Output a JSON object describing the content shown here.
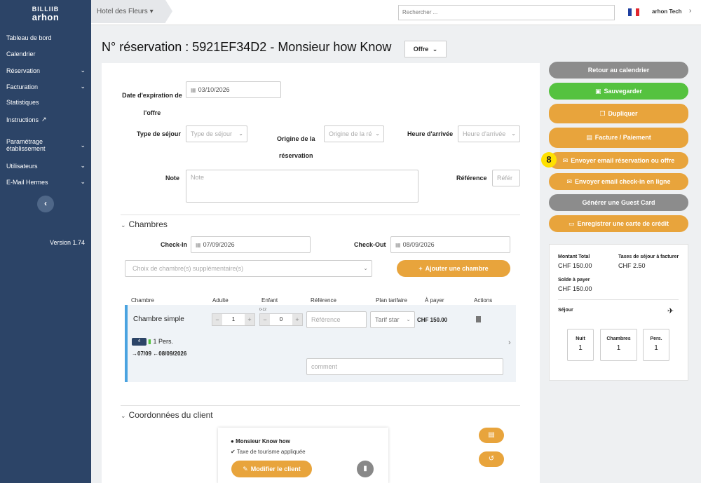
{
  "sidebar": {
    "logo_top": "BILLIIB",
    "logo_bottom": "arhon",
    "items": [
      {
        "label": "Tableau de bord"
      },
      {
        "label": "Calendrier"
      },
      {
        "label": "Réservation"
      },
      {
        "label": "Facturation"
      },
      {
        "label": "Statistiques"
      },
      {
        "label": "Instructions"
      },
      {
        "label": "Paramétrage établissement"
      },
      {
        "label": "Utilisateurs"
      },
      {
        "label": "E-Mail Hermes"
      }
    ],
    "version": "Version 1.74"
  },
  "topbar": {
    "hotel": "Hotel des Fleurs",
    "search_placeholder": "Rechercher ...",
    "user": "arhon Tech"
  },
  "page": {
    "title": "N° réservation : 5921EF34D2 - Monsieur how Know",
    "type_button": "Offre"
  },
  "form": {
    "expiration_label": "Date d'expiration de l'offre",
    "expiration_line1": "Date d'expiration de",
    "expiration_line2": "l'offre",
    "expiration_value": "03/10/2026",
    "sejour_label": "Type de séjour",
    "sejour_placeholder": "Type de séjour",
    "origine_line1": "Origine de la",
    "origine_line2": "réservation",
    "origine_placeholder": "Origine de la ré",
    "arrivee_label": "Heure d'arrivée",
    "arrivee_placeholder": "Heure d'arrivée",
    "note_label": "Note",
    "note_placeholder": "Note",
    "reference_label": "Référence",
    "reference_placeholder": "Référ"
  },
  "chambres": {
    "title": "Chambres",
    "checkin_label": "Check-In",
    "checkin_value": "07/09/2026",
    "checkout_label": "Check-Out",
    "checkout_value": "08/09/2026",
    "extra_placeholder": "Choix de chambre(s) supplémentaire(s)",
    "add_button": "Ajouter une chambre",
    "columns": [
      "Chambre",
      "Adulte",
      "Enfant",
      "Référence",
      "Plan tarifaire",
      "À payer",
      "Actions"
    ],
    "child_range": "0-12",
    "rows": [
      {
        "name": "Chambre simple",
        "adults": "1",
        "children": "0",
        "reference_placeholder": "Référence",
        "plan": "Tarif star",
        "amount": "CHF 150.00",
        "bed_badge": "4",
        "persons": "1 Pers.",
        "dates": "07/09",
        "dates_end": "08/09/2026",
        "comment_placeholder": "comment"
      }
    ]
  },
  "client": {
    "title": "Coordonnées du client",
    "name": "Monsieur  Know how",
    "tax": "Taxe de tourisme appliquée",
    "edit_button": "Modifier le client"
  },
  "actions": {
    "retour": "Retour au calendrier",
    "save": "Sauvegarder",
    "duplicate": "Dupliquer",
    "invoice": "Facture / Paiement",
    "email_offer": "Envoyer email réservation ou offre",
    "email_checkin": "Envoyer email check-in en ligne",
    "guest_card": "Générer une Guest Card",
    "credit_card": "Enregistrer une carte de crédit",
    "step_badge": "8"
  },
  "summary": {
    "montant_label": "Montant Total",
    "montant_value": "CHF 150.00",
    "taxes_label": "Taxes de séjour à facturer",
    "taxes_value": "CHF 2.50",
    "solde_label": "Solde à payer",
    "solde_value": "CHF 150.00",
    "sejour_label": "Séjour",
    "nuit_label": "Nuit",
    "nuit_value": "1",
    "chambres_label": "Chambres",
    "chambres_value": "1",
    "pers_label": "Pers.",
    "pers_value": "1"
  },
  "colors": {
    "sidebar": "#2c4467",
    "orange": "#e8a43c",
    "green": "#55c23f",
    "gray": "#8c8c8c",
    "accent_blue": "#4aa3e0",
    "badge_yellow": "#ffe100"
  },
  "icons": {
    "flag": "france-flag-icon",
    "calendar": "calendar-icon",
    "external": "external-link-icon",
    "save": "floppy-icon",
    "copy": "copy-icon",
    "invoice": "document-icon",
    "mail": "envelope-icon",
    "card": "credit-card-icon",
    "plus": "plus-icon",
    "plane": "plane-landing-icon",
    "person": "user-icon",
    "check": "check-circle-icon",
    "trash": "trash-icon",
    "bed": "bed-icon",
    "history": "history-icon",
    "receipt": "receipt-icon"
  }
}
